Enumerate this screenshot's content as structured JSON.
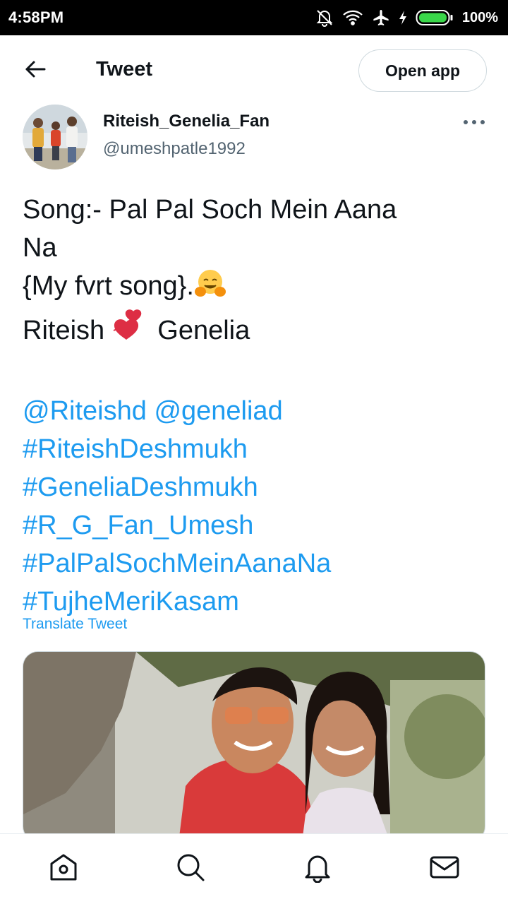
{
  "status_bar": {
    "time": "4:58PM",
    "battery": "100%",
    "icons": [
      "mute-bell-icon",
      "wifi-icon",
      "airplane-icon",
      "charging-bolt-icon",
      "battery-icon"
    ]
  },
  "header": {
    "back_icon": "arrow-left-icon",
    "title": "Tweet",
    "open_app_label": "Open app"
  },
  "author": {
    "name": "Riteish_Genelia_Fan",
    "handle": "@umeshpatle1992",
    "more_icon": "more-horizontal-icon"
  },
  "tweet": {
    "line1": "Song:- Pal Pal Soch Mein Aana",
    "line2": "Na",
    "line3": "{My fvrt song}.",
    "line3_emoji": "hugging-face-emoji",
    "line4_a": "Riteish",
    "line4_emoji": "two-hearts-emoji",
    "line4_b": "Genelia",
    "mentions": [
      "@Riteishd",
      "@geneliad"
    ],
    "hashtags": [
      "#RiteishDeshmukh",
      "#GeneliaDeshmukh",
      "#R_G_Fan_Umesh",
      "#PalPalSochMeinAanaNa",
      "#TujheMeriKasam"
    ]
  },
  "translate_label": "Translate Tweet",
  "bottom_nav": {
    "items": [
      "home-icon",
      "search-icon",
      "notifications-icon",
      "messages-icon"
    ]
  },
  "colors": {
    "accent": "#1d9bf0",
    "text": "#0f1419",
    "secondary_text": "#536471",
    "border": "#cfd9de"
  }
}
